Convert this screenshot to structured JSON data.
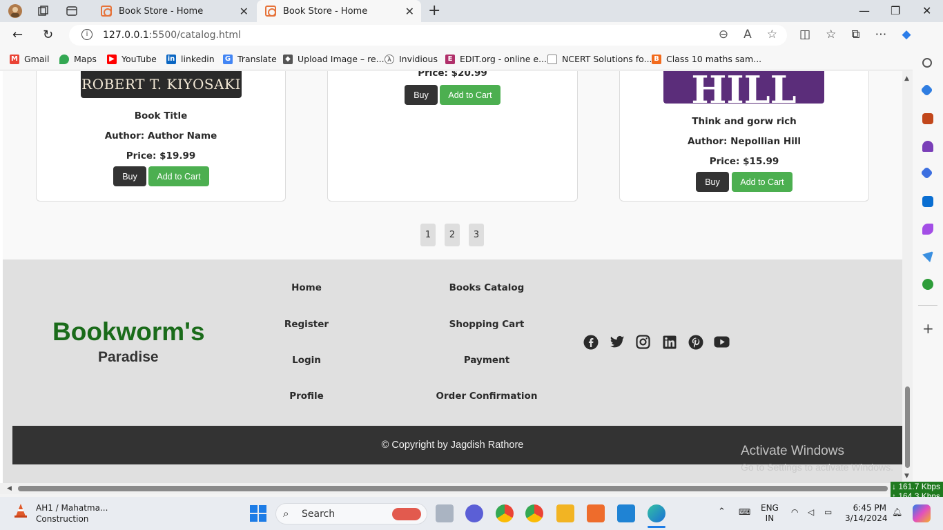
{
  "browser": {
    "tabs": [
      {
        "title": "Book Store - Home",
        "active": false
      },
      {
        "title": "Book Store - Home",
        "active": true
      }
    ],
    "url_host": "127.0.0.1",
    "url_path": ":5500/catalog.html",
    "bookmarks": [
      {
        "label": "Gmail",
        "color": "#ea4335"
      },
      {
        "label": "Maps",
        "color": "#34a853"
      },
      {
        "label": "YouTube",
        "color": "#ff0000"
      },
      {
        "label": "linkedin",
        "color": "#0a66c2"
      },
      {
        "label": "Translate",
        "color": "#4285f4"
      },
      {
        "label": "Upload Image – re...",
        "color": "#555555"
      },
      {
        "label": "Invidious",
        "color": "#777777"
      },
      {
        "label": "EDIT.org - online e...",
        "color": "#b0306a"
      },
      {
        "label": "NCERT Solutions fo...",
        "color": "#888888"
      },
      {
        "label": "Class 10 maths sam...",
        "color": "#f26b1d"
      }
    ]
  },
  "books": [
    {
      "cover_text": "ROBERT T. KIYOSAKI",
      "title": "Book Title",
      "author": "Author: Author Name",
      "price": "Price: $19.99"
    },
    {
      "cover_text": "",
      "title": "",
      "author": "",
      "price": "Price: $20.99"
    },
    {
      "cover_text": "HILL",
      "title": "Think and gorw rich",
      "author": "Author: Nepollian Hill",
      "price": "Price: $15.99"
    }
  ],
  "buttons": {
    "buy": "Buy",
    "add_to_cart": "Add to Cart"
  },
  "pagination": [
    "1",
    "2",
    "3"
  ],
  "footer": {
    "brand_line1": "Bookworm's",
    "brand_line2": "Paradise",
    "links_col1": [
      "Home",
      "Register",
      "Login",
      "Profile"
    ],
    "links_col2": [
      "Books Catalog",
      "Shopping Cart",
      "Payment",
      "Order Confirmation"
    ],
    "social": [
      "facebook-icon",
      "twitter-icon",
      "instagram-icon",
      "linkedin-icon",
      "pinterest-icon",
      "youtube-icon"
    ],
    "copyright": "© Copyright by Jagdish Rathore"
  },
  "watermark": {
    "line1": "Activate Windows",
    "line2": "Go to Settings to activate Windows."
  },
  "netspeed": {
    "down": "↓ 161.7 Kbps",
    "up": "↑ 164.3 Kbps"
  },
  "taskbar": {
    "weather_title": "AH1 / Mahatma...",
    "weather_sub": "Construction",
    "search_label": "Search",
    "lang": "ENG",
    "region": "IN",
    "time": "6:45 PM",
    "date": "3/14/2024"
  },
  "colors": {
    "brand_green": "#1a6b1a",
    "cart_green": "#4caf50",
    "buy_dark": "#333333"
  }
}
